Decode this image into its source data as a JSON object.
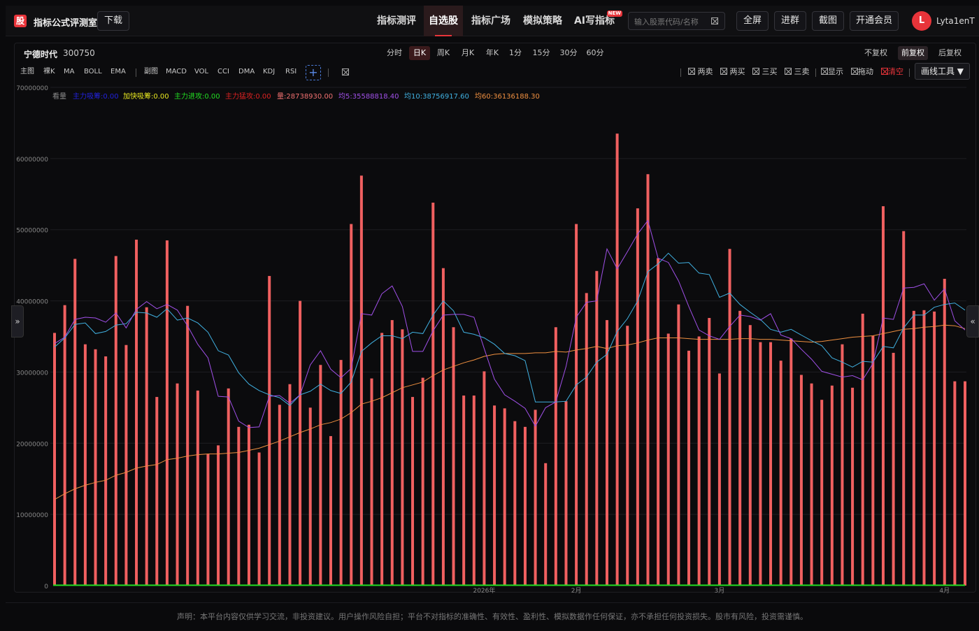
{
  "header": {
    "logo_char": "股",
    "app_name": "指标公式评测室",
    "download_label": "下载",
    "tabs": [
      {
        "label": "指标测评",
        "active": false
      },
      {
        "label": "自选股",
        "active": true
      },
      {
        "label": "指标广场",
        "active": false
      },
      {
        "label": "模拟策略",
        "active": false
      },
      {
        "label": "AI写指标",
        "active": false,
        "badge": "NEW"
      }
    ],
    "search_placeholder": "输入股票代码/名称",
    "fullscreen_label": "全屏",
    "group_label": "进群",
    "screenshot_label": "截图",
    "vip_label": "开通会员",
    "avatar_initial": "L",
    "username": "Lyta1enT"
  },
  "stock": {
    "name": "宁德时代",
    "code": "300750"
  },
  "periods": [
    {
      "label": "分时",
      "active": false
    },
    {
      "label": "日K",
      "active": true
    },
    {
      "label": "周K",
      "active": false
    },
    {
      "label": "月K",
      "active": false
    },
    {
      "label": "年K",
      "active": false
    },
    {
      "label": "1分",
      "active": false
    },
    {
      "label": "15分",
      "active": false
    },
    {
      "label": "30分",
      "active": false
    },
    {
      "label": "60分",
      "active": false
    }
  ],
  "adjustments": [
    {
      "label": "不复权",
      "active": false
    },
    {
      "label": "前复权",
      "active": true
    },
    {
      "label": "后复权",
      "active": false
    }
  ],
  "indicator_bar": {
    "main": [
      "主图",
      "裸K",
      "MA",
      "BOLL",
      "EMA"
    ],
    "sub": [
      "副图",
      "MACD",
      "VOL",
      "CCI",
      "DMA",
      "KDJ",
      "RSI"
    ],
    "add_label": "+"
  },
  "tools": [
    {
      "label": "两卖",
      "red": false
    },
    {
      "label": "两买",
      "red": false
    },
    {
      "label": "三买",
      "red": false
    },
    {
      "label": "三卖",
      "red": false
    },
    {
      "label": "显示",
      "red": false
    },
    {
      "label": "拖动",
      "red": false
    },
    {
      "label": "清空",
      "red": true
    }
  ],
  "draw_tools_label": "画线工具 ▼",
  "legend": [
    {
      "text": "看量",
      "color": "#8a8a8a"
    },
    {
      "text": "主力吸筹:0.00",
      "color": "#2222dd"
    },
    {
      "text": "加快吸筹:0.00",
      "color": "#e8e820"
    },
    {
      "text": "主力进攻:0.00",
      "color": "#22dd22"
    },
    {
      "text": "主力猛攻:0.00",
      "color": "#dd2222"
    },
    {
      "text": "量:28738930.00",
      "color": "#f07070"
    },
    {
      "text": "均5:35588818.40",
      "color": "#a050e8"
    },
    {
      "text": "均10:38756917.60",
      "color": "#40b0e0"
    },
    {
      "text": "均60:36136188.30",
      "color": "#f09040"
    }
  ],
  "side_handles": {
    "left": "»",
    "right": "«"
  },
  "chart_data": {
    "type": "bar",
    "ylim": [
      0,
      70000000
    ],
    "y_ticks": [
      "0",
      "10000000",
      "20000000",
      "30000000",
      "40000000",
      "50000000",
      "60000000",
      "70000000"
    ],
    "x_labels": [
      {
        "label": "2026年",
        "index": 42
      },
      {
        "label": "2月",
        "index": 51
      },
      {
        "label": "3月",
        "index": 65
      },
      {
        "label": "4月",
        "index": 87
      }
    ],
    "colors": {
      "volume": "#f06060",
      "ma5": "#a050e8",
      "ma10": "#40b0e0",
      "ma60": "#f09040",
      "zero_line": "#22dd22"
    },
    "volume": [
      35500000,
      39400000,
      45900000,
      33900000,
      33200000,
      32200000,
      46300000,
      33800000,
      48600000,
      39100000,
      26500000,
      48500000,
      28400000,
      39300000,
      27400000,
      18500000,
      19700000,
      27700000,
      22300000,
      22600000,
      18700000,
      43500000,
      25400000,
      28300000,
      40000000,
      25000000,
      31000000,
      21000000,
      31700000,
      50800000,
      57600000,
      29100000,
      35500000,
      37300000,
      36000000,
      26500000,
      29200000,
      53800000,
      44600000,
      36300000,
      26700000,
      26700000,
      30100000,
      25300000,
      24900000,
      23100000,
      22300000,
      24700000,
      17200000,
      36300000,
      25900000,
      50800000,
      41100000,
      44200000,
      37300000,
      63500000,
      36500000,
      53000000,
      57800000,
      46000000,
      35400000,
      39500000,
      33000000,
      35000000,
      37600000,
      29800000,
      47300000,
      38600000,
      36600000,
      34200000,
      34200000,
      31600000,
      34700000,
      29600000,
      28400000,
      26100000,
      28100000,
      33900000,
      27800000,
      38200000,
      35100000,
      53300000,
      32700000,
      49800000,
      38600000,
      38700000,
      38500000,
      43100000,
      28700000,
      28700000
    ],
    "ma5": [
      34000000,
      34900000,
      37400000,
      37700000,
      37600000,
      37000000,
      38300000,
      36200000,
      38800000,
      39900000,
      38900000,
      39500000,
      38700000,
      36500000,
      33900000,
      32000000,
      26600000,
      26500000,
      23100000,
      22200000,
      22300000,
      26600000,
      26700000,
      25600000,
      26800000,
      31000000,
      33000000,
      30400000,
      29200000,
      30500000,
      38200000,
      38000000,
      41000000,
      42100000,
      39200000,
      32900000,
      32900000,
      35800000,
      38000000,
      38100000,
      38100000,
      37700000,
      33300000,
      29000000,
      26800000,
      25900000,
      24900000,
      22400000,
      25000000,
      25800000,
      30800000,
      37700000,
      39800000,
      40000000,
      47300000,
      44500000,
      46900000,
      49400000,
      51300000,
      46000000,
      45400000,
      42800000,
      39200000,
      35900000,
      35100000,
      34600000,
      36400000,
      38000000,
      37800000,
      37300000,
      38200000,
      35200000,
      34700000,
      33200000,
      31800000,
      30100000,
      29700000,
      29300000,
      29500000,
      28900000,
      31200000,
      37600000,
      37400000,
      41800000,
      41900000,
      42400000,
      40100000,
      41700000,
      37200000,
      35900000
    ],
    "ma10": [
      33500000,
      34800000,
      36700000,
      36900000,
      35400000,
      35700000,
      36600000,
      36800000,
      38400000,
      38300000,
      37700000,
      38900000,
      37300000,
      37600000,
      36900000,
      35600000,
      33000000,
      32400000,
      29900000,
      28300000,
      27400000,
      26800000,
      26400000,
      25300000,
      26800000,
      27300000,
      28300000,
      27400000,
      27000000,
      28600000,
      32900000,
      34100000,
      35100000,
      35100000,
      34700000,
      35600000,
      35400000,
      38000000,
      40000000,
      38600000,
      35600000,
      35300000,
      34800000,
      33900000,
      32600000,
      32300000,
      31600000,
      25800000,
      25800000,
      25800000,
      25900000,
      28200000,
      29300000,
      31400000,
      32500000,
      35700000,
      37500000,
      40000000,
      44100000,
      45200000,
      46700000,
      45300000,
      45400000,
      43900000,
      43700000,
      40500000,
      41100000,
      39500000,
      38400000,
      37400000,
      36000000,
      35600000,
      36000000,
      35200000,
      34400000,
      33700000,
      32000000,
      31400000,
      30700000,
      31500000,
      31400000,
      33600000,
      33400000,
      36200000,
      38000000,
      38000000,
      39100000,
      39500000,
      39700000,
      38700000
    ],
    "ma60": [
      12100000,
      12900000,
      13600000,
      14100000,
      14500000,
      14800000,
      15500000,
      15900000,
      16500000,
      16800000,
      17000000,
      17700000,
      17900000,
      18200000,
      18400000,
      18500000,
      18500000,
      18600000,
      18700000,
      19000000,
      19300000,
      19800000,
      20300000,
      20900000,
      21500000,
      22000000,
      22600000,
      22900000,
      23400000,
      24300000,
      25500000,
      25900000,
      26400000,
      27100000,
      27800000,
      28200000,
      28600000,
      29500000,
      30300000,
      30800000,
      31300000,
      31700000,
      32200000,
      32500000,
      32600000,
      32600000,
      32600000,
      32700000,
      32700000,
      32900000,
      32800000,
      33100000,
      33300000,
      33600000,
      33300000,
      33700000,
      33800000,
      34100000,
      34500000,
      34800000,
      34800000,
      34800000,
      34700000,
      34600000,
      34600000,
      34600000,
      34600000,
      34700000,
      34700000,
      34600000,
      34600000,
      34500000,
      34400000,
      34300000,
      34200000,
      34300000,
      34500000,
      34700000,
      34900000,
      35000000,
      35100000,
      35400000,
      35700000,
      36000000,
      36100000,
      36300000,
      36400000,
      36600000,
      36500000,
      36100000
    ]
  },
  "disclaimer": "声明：本平台内容仅供学习交流，非投资建议。用户操作风险自担；平台不对指标的准确性、有效性、盈利性、模拟数据作任何保证，亦不承担任何投资损失。股市有风险，投资需谨慎。"
}
